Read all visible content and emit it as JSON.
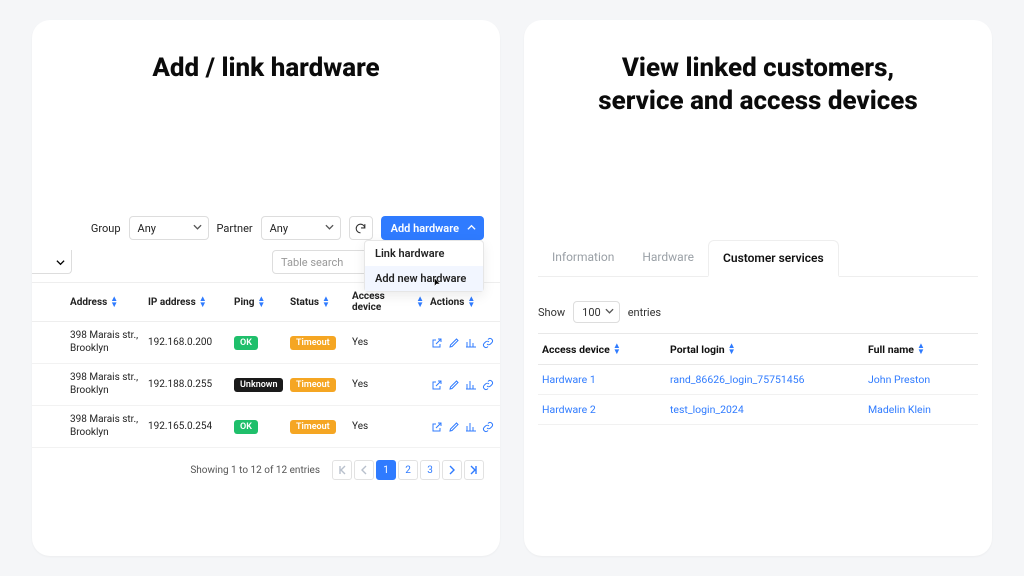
{
  "left": {
    "title": "Add / link hardware",
    "filters": {
      "group_label": "Group",
      "group_value": "Any",
      "partner_label": "Partner",
      "partner_value": "Any"
    },
    "add_hw_label": "Add hardware",
    "dropdown": {
      "link": "Link hardware",
      "add_new": "Add new hardware"
    },
    "search_placeholder": "Table search",
    "columns": {
      "address": "Address",
      "ip": "IP address",
      "ping": "Ping",
      "status": "Status",
      "access": "Access device",
      "actions": "Actions"
    },
    "rows": [
      {
        "address": "398 Marais str., Brooklyn",
        "ip": "192.168.0.200",
        "ping": "OK",
        "ping_cls": "ok",
        "status": "Timeout",
        "access": "Yes"
      },
      {
        "address": "398 Marais str., Brooklyn",
        "ip": "192.188.0.255",
        "ping": "Unknown",
        "ping_cls": "unknown",
        "status": "Timeout",
        "access": "Yes"
      },
      {
        "address": "398 Marais str., Brooklyn",
        "ip": "192.165.0.254",
        "ping": "OK",
        "ping_cls": "ok",
        "status": "Timeout",
        "access": "Yes"
      }
    ],
    "pager_text": "Showing 1 to 12 of 12 entries",
    "pages": [
      "1",
      "2",
      "3"
    ]
  },
  "right": {
    "title": "View linked customers,\nservice and access devices",
    "tabs": {
      "info": "Information",
      "hardware": "Hardware",
      "services": "Customer services"
    },
    "show_label": "Show",
    "show_value": "100",
    "entries_label": "entries",
    "columns": {
      "access": "Access device",
      "login": "Portal login",
      "name": "Full name"
    },
    "rows": [
      {
        "device": "Hardware 1",
        "login": "rand_86626_login_75751456",
        "name": "John Preston"
      },
      {
        "device": "Hardware 2",
        "login": "test_login_2024",
        "name": "Madelin Klein"
      }
    ]
  }
}
